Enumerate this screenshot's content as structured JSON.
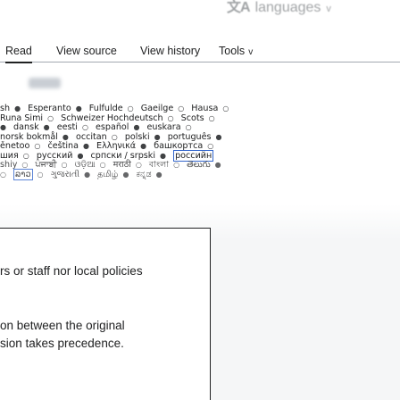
{
  "language_menu": {
    "glyph": "文A",
    "label": "languages",
    "chevron": "v"
  },
  "tabs": [
    {
      "label": "Read"
    },
    {
      "label": "View source"
    },
    {
      "label": "View history"
    },
    {
      "label": "Tools",
      "chevron": "v"
    }
  ],
  "languages": {
    "rows": [
      [
        "sh",
        "Esperanto",
        "Fulfulde",
        "Gaeilge",
        "Hausa"
      ],
      [
        "Runa Simi",
        "Schweizer Hochdeutsch",
        "Scots"
      ],
      [
        "dansk",
        "eesti",
        "español",
        "euskara"
      ],
      [
        "norsk bokmål",
        "occitan",
        "polski",
        "português"
      ],
      [
        "ěnetoo",
        "čeština",
        "Ελληνικά",
        "башкортса"
      ],
      [
        "шия",
        "русский",
        "српски / srpski",
        "российн"
      ],
      [
        "shiy",
        "ਪੰਜਾਬੀ",
        "ଓଡ଼ିଆ",
        "मराठी",
        "বাংলা",
        "తెలుగు"
      ],
      [
        "ລາວ",
        "ગુજરાતી",
        "தமிழ்",
        "ಕನ್ನಡ",
        "മലയാളം"
      ]
    ]
  },
  "notice": {
    "line1": "rs or staff nor local policies",
    "line2": "on between the original",
    "line3": "sion takes precedence."
  }
}
